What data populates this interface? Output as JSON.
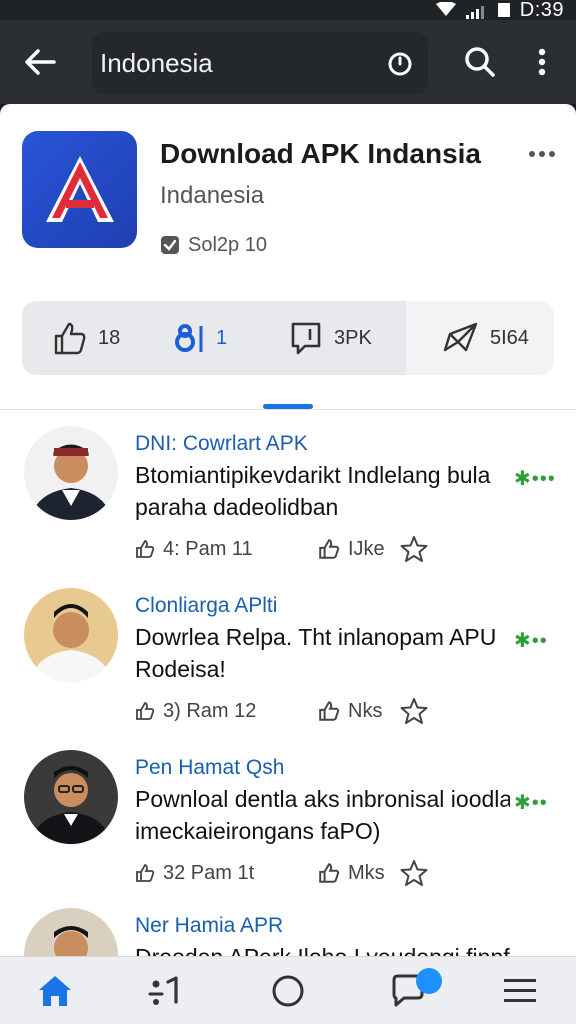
{
  "status_bar": {
    "time": "D:39"
  },
  "top_bar": {
    "search_text": "Indonesia"
  },
  "app": {
    "title": "Download APK Indansia",
    "subtitle": "Indanesia",
    "meta": "Sol2p 10",
    "icon_letter": "A",
    "icon_color": "#2a55d8"
  },
  "actions": [
    {
      "icon": "thumbs-up-icon",
      "label": "18"
    },
    {
      "icon": "bar-icon",
      "label": "1"
    },
    {
      "icon": "comment-icon",
      "label": "3PK"
    },
    {
      "icon": "share-icon",
      "label": "5I64"
    }
  ],
  "posts": [
    {
      "author": "DNI: Cowrlart APK",
      "line1": "Btomiantipikevdarikt Indlelang bula",
      "line2": "paraha dadeolidban",
      "stats": "4: Pam 11",
      "likes": "IJke"
    },
    {
      "author": "Clonliarga APlti",
      "line1": "Dowrlea Relpa. Tht inlanopam APU",
      "line2": "Rodeisa!",
      "stats": "3) Ram 12",
      "likes": "Nks"
    },
    {
      "author": "Pen Hamat Qsh",
      "line1": "Pownloal dentla aks inbronisal ioodla",
      "line2": "imeckaieirongans faPO)",
      "stats": "32 Pam 1t",
      "likes": "Mks"
    },
    {
      "author": "Ner Hamia APR",
      "line1": "Dreoden APerk Ilehe I veudengi finnfnie",
      "line2": "",
      "stats": "",
      "likes": ""
    }
  ],
  "colors": {
    "accent": "#1a73e8",
    "author": "#1a5fae",
    "more_dots": "#2e9e3a"
  }
}
